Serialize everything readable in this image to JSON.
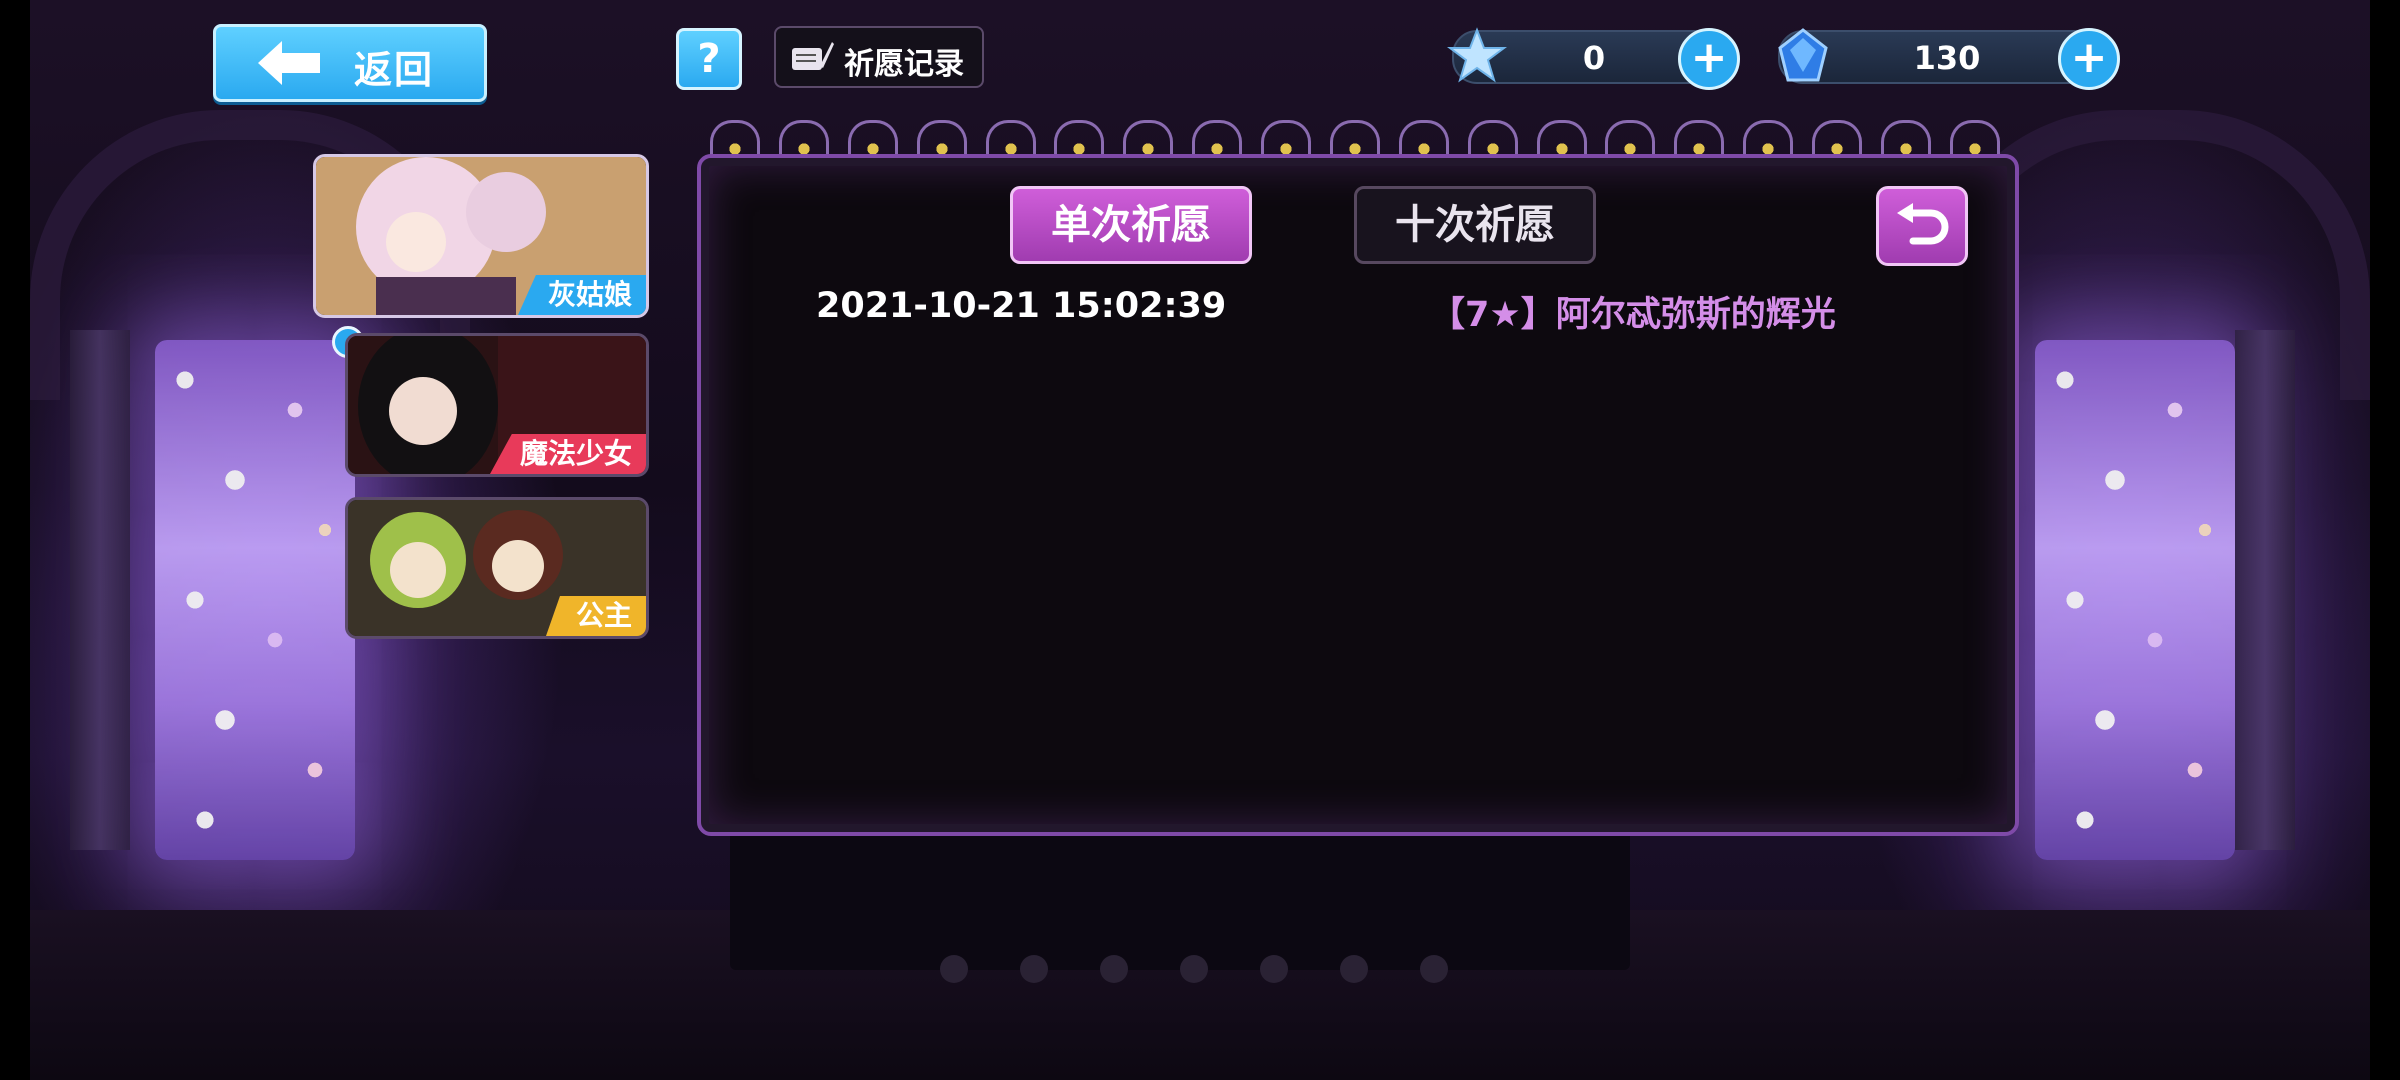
{
  "header": {
    "back_label": "返回",
    "help_label": "?",
    "record_label": "祈愿记录"
  },
  "currencies": [
    {
      "icon": "star-crystal-icon",
      "value": "0"
    },
    {
      "icon": "blue-gem-icon",
      "value": "130"
    }
  ],
  "characters": [
    {
      "label": "灰姑娘",
      "color": "#2aa9f0",
      "selected": true
    },
    {
      "label": "魔法少女",
      "color": "#e83a5a",
      "selected": false,
      "has_notification": true
    },
    {
      "label": "公主",
      "color": "#f0b52a",
      "selected": false
    }
  ],
  "panel": {
    "tabs": [
      {
        "label": "单次祈愿",
        "active": true
      },
      {
        "label": "十次祈愿",
        "active": false
      }
    ],
    "records": [
      {
        "time": "2021-10-21 15:02:39",
        "item": "【7★】阿尔忒弥斯的辉光"
      }
    ]
  },
  "colors": {
    "accent_blue": "#2aa9f0",
    "accent_purple": "#b44ac4",
    "record_item_text": "#d48ee8"
  }
}
